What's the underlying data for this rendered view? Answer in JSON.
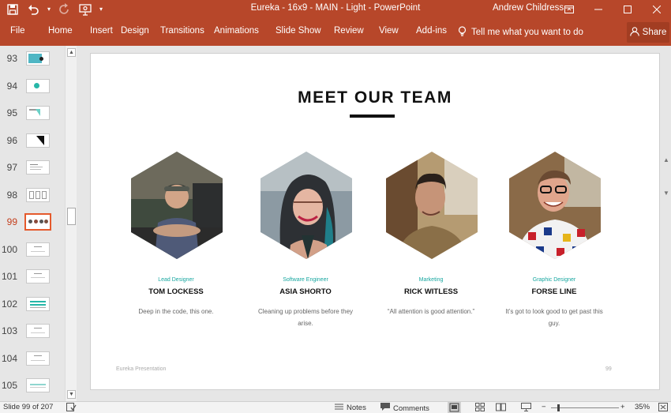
{
  "window": {
    "title": "Eureka - 16x9 - MAIN - Light  -  PowerPoint",
    "user": "Andrew Childress",
    "accent": "#b7472a"
  },
  "ribbon": {
    "tabs": [
      "File",
      "Home",
      "Insert",
      "Design",
      "Transitions",
      "Animations",
      "Slide Show",
      "Review",
      "View",
      "Add-ins"
    ],
    "tell_me": "Tell me what you want to do",
    "share": "Share"
  },
  "thumbnails": {
    "numbers": [
      "93",
      "94",
      "95",
      "96",
      "97",
      "98",
      "99",
      "100",
      "101",
      "102",
      "103",
      "104",
      "105"
    ],
    "active": "99"
  },
  "slide": {
    "title": "MEET OUR TEAM",
    "team": [
      {
        "role": "Lead Designer",
        "name": "TOM LOCKESS",
        "quote": "Deep in the code, this one."
      },
      {
        "role": "Software Engineer",
        "name": "ASIA SHORTO",
        "quote": "Cleaning up problems before they arise."
      },
      {
        "role": "Marketing",
        "name": "RICK WITLESS",
        "quote": "“All attention is good attention.”"
      },
      {
        "role": "Graphic Designer",
        "name": "FORSE LINE",
        "quote": "It’s got to look good to get past this guy."
      }
    ],
    "footer_left": "Eureka Presentation",
    "footer_right": "99",
    "accent_teal": "#18a7a0"
  },
  "status": {
    "slide_info": "Slide 99 of 207",
    "notes": "Notes",
    "comments": "Comments",
    "zoom": "35%"
  }
}
